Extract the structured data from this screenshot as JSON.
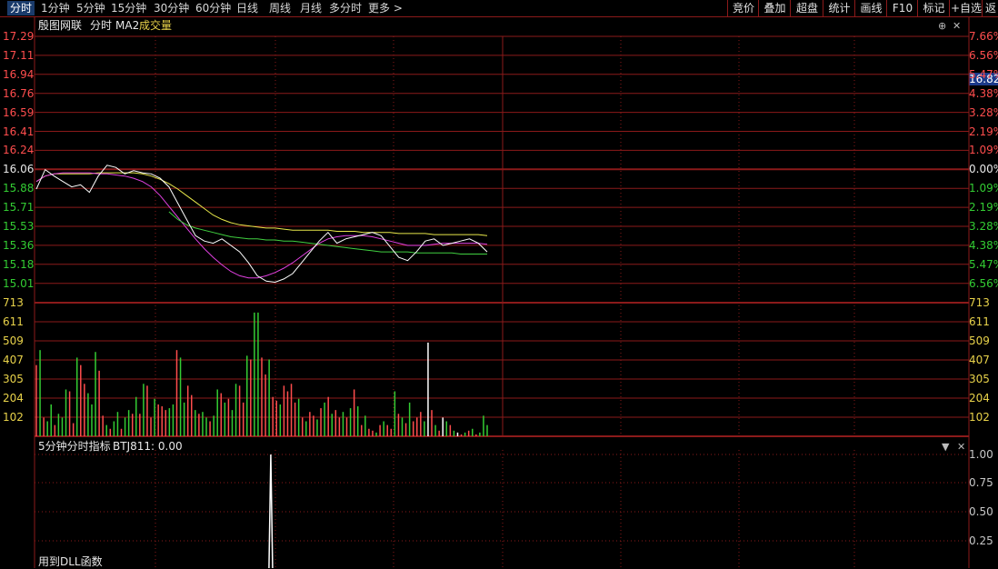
{
  "toolbar": {
    "left_tabs": [
      {
        "label": "分时",
        "active": true
      },
      {
        "label": "1分钟"
      },
      {
        "label": "5分钟"
      },
      {
        "label": "15分钟"
      },
      {
        "label": "30分钟"
      },
      {
        "label": "60分钟"
      },
      {
        "label": "日线"
      },
      {
        "label": "周线"
      },
      {
        "label": "月线"
      },
      {
        "label": "多分时"
      },
      {
        "label": "更多 >"
      }
    ],
    "right_buttons": [
      {
        "label": "竞价"
      },
      {
        "label": "叠加"
      },
      {
        "label": "超盘"
      },
      {
        "label": "统计"
      },
      {
        "label": "画线"
      },
      {
        "label": "F10"
      },
      {
        "label": "标记"
      },
      {
        "label": "+自选"
      },
      {
        "label": "返"
      }
    ]
  },
  "legend": {
    "p1": "殷图网联",
    "p2": "分时",
    "p3": "MA2",
    "p4": "成交量"
  },
  "price_axis": {
    "left": [
      "17.29",
      "17.11",
      "16.94",
      "16.76",
      "16.59",
      "16.41",
      "16.24",
      "16.06",
      "15.88",
      "15.71",
      "15.53",
      "15.36",
      "15.18",
      "15.01"
    ],
    "right": [
      "7.66%",
      "6.56%",
      "5.47%",
      "4.38%",
      "3.28%",
      "2.19%",
      "1.09%",
      "0.00%",
      "1.09%",
      "2.19%",
      "3.28%",
      "4.38%",
      "5.47%",
      "6.56%"
    ],
    "current_price": "16.82"
  },
  "volume_axis": [
    "713",
    "611",
    "509",
    "407",
    "305",
    "204",
    "102"
  ],
  "indicator": {
    "title": "5分钟分时指标",
    "value_label": "BTJ811: 0.00",
    "note": "用到DLL函数",
    "axis": [
      "1.00",
      "0.75",
      "0.50",
      "0.25"
    ]
  },
  "colors": {
    "up": "#ff4d4d",
    "down": "#33cc33",
    "grid": "#8b1a1a",
    "price_line": "#ffffff",
    "ma_yellow": "#e8e84a",
    "ma_magenta": "#e040e0",
    "ma_green": "#40d040"
  },
  "chart_data": {
    "type": "line",
    "price_range": [
      15.01,
      17.29
    ],
    "base_price": 16.06,
    "price_series": [
      15.88,
      16.06,
      16.0,
      15.95,
      15.9,
      15.92,
      15.85,
      16.0,
      16.1,
      16.08,
      16.02,
      16.05,
      16.03,
      16.02,
      15.98,
      15.9,
      15.75,
      15.6,
      15.45,
      15.4,
      15.38,
      15.42,
      15.36,
      15.3,
      15.2,
      15.08,
      15.03,
      15.02,
      15.05,
      15.1,
      15.2,
      15.3,
      15.4,
      15.48,
      15.38,
      15.42,
      15.44,
      15.46,
      15.48,
      15.45,
      15.35,
      15.25,
      15.22,
      15.3,
      15.4,
      15.42,
      15.36,
      15.38,
      15.4,
      15.42,
      15.38,
      15.3
    ],
    "ma_yellow": [
      15.95,
      16.0,
      16.02,
      16.02,
      16.02,
      16.02,
      16.02,
      16.03,
      16.03,
      16.03,
      16.03,
      16.03,
      16.02,
      16.0,
      15.97,
      15.93,
      15.88,
      15.82,
      15.76,
      15.7,
      15.64,
      15.6,
      15.57,
      15.55,
      15.54,
      15.53,
      15.52,
      15.52,
      15.51,
      15.5,
      15.5,
      15.5,
      15.5,
      15.5,
      15.49,
      15.49,
      15.49,
      15.48,
      15.48,
      15.48,
      15.48,
      15.47,
      15.47,
      15.47,
      15.47,
      15.46,
      15.46,
      15.46,
      15.46,
      15.46,
      15.46,
      15.45
    ],
    "ma_magenta": [
      15.95,
      16.0,
      16.02,
      16.03,
      16.03,
      16.03,
      16.03,
      16.02,
      16.02,
      16.01,
      16.0,
      15.98,
      15.95,
      15.9,
      15.82,
      15.72,
      15.62,
      15.52,
      15.42,
      15.33,
      15.25,
      15.18,
      15.12,
      15.08,
      15.06,
      15.06,
      15.08,
      15.11,
      15.15,
      15.2,
      15.26,
      15.32,
      15.38,
      15.42,
      15.44,
      15.45,
      15.45,
      15.45,
      15.44,
      15.42,
      15.4,
      15.38,
      15.36,
      15.36,
      15.36,
      15.37,
      15.38,
      15.38,
      15.38,
      15.38,
      15.38,
      15.37
    ],
    "ma_green": [
      null,
      null,
      null,
      null,
      null,
      null,
      null,
      null,
      null,
      null,
      null,
      null,
      null,
      null,
      null,
      15.67,
      15.6,
      15.55,
      15.52,
      15.5,
      15.48,
      15.46,
      15.44,
      15.43,
      15.42,
      15.42,
      15.41,
      15.41,
      15.4,
      15.4,
      15.39,
      15.38,
      15.37,
      15.36,
      15.35,
      15.34,
      15.33,
      15.32,
      15.31,
      15.3,
      15.3,
      15.3,
      15.3,
      15.29,
      15.29,
      15.29,
      15.29,
      15.29,
      15.28,
      15.28,
      15.28,
      15.28
    ],
    "volumes": [
      380,
      460,
      100,
      80,
      170,
      60,
      120,
      100,
      250,
      240,
      70,
      420,
      380,
      280,
      230,
      170,
      450,
      350,
      110,
      60,
      40,
      80,
      130,
      40,
      100,
      140,
      120,
      210,
      120,
      280,
      270,
      100,
      200,
      170,
      160,
      140,
      150,
      170,
      460,
      420,
      180,
      270,
      220,
      140,
      120,
      130,
      100,
      80,
      110,
      250,
      230,
      180,
      200,
      140,
      280,
      270,
      180,
      430,
      410,
      660,
      660,
      420,
      330,
      410,
      210,
      190,
      170,
      270,
      240,
      280,
      180,
      200,
      100,
      80,
      130,
      110,
      90,
      150,
      180,
      210,
      120,
      140,
      100,
      130,
      100,
      150,
      250,
      160,
      60,
      110,
      40,
      30,
      20,
      60,
      80,
      60,
      40,
      240,
      120,
      100,
      70,
      180,
      80,
      100,
      130,
      80,
      500,
      140,
      60,
      30,
      100,
      80,
      60,
      30,
      20,
      10,
      20,
      30,
      40,
      10,
      20,
      110,
      60
    ],
    "volume_colors_up": [
      1,
      0,
      1,
      0,
      0,
      1,
      0,
      0,
      0,
      1,
      1,
      0,
      1,
      1,
      0,
      0,
      0,
      1,
      1,
      0,
      1,
      0,
      0,
      1,
      0,
      0,
      1,
      0,
      1,
      0,
      1,
      1,
      0,
      1,
      1,
      1,
      0,
      0,
      1,
      0,
      0,
      1,
      1,
      0,
      1,
      0,
      0,
      1,
      0,
      0,
      1,
      0,
      1,
      0,
      0,
      1,
      1,
      0,
      1,
      0,
      0,
      1,
      1,
      0,
      1,
      1,
      0,
      1,
      1,
      1,
      1,
      0,
      1,
      0,
      1,
      1,
      0,
      1,
      0,
      1,
      0,
      1,
      1,
      0,
      1,
      0,
      1,
      0,
      1,
      0,
      1,
      1,
      0,
      1,
      0,
      1,
      1,
      0,
      1,
      0,
      1,
      0,
      1,
      1,
      1,
      0,
      2,
      1,
      0,
      1,
      2,
      0,
      1,
      0,
      2,
      1,
      0,
      1,
      0,
      1,
      0,
      0,
      0,
      1
    ],
    "indicator_spike_at": 0.52
  }
}
